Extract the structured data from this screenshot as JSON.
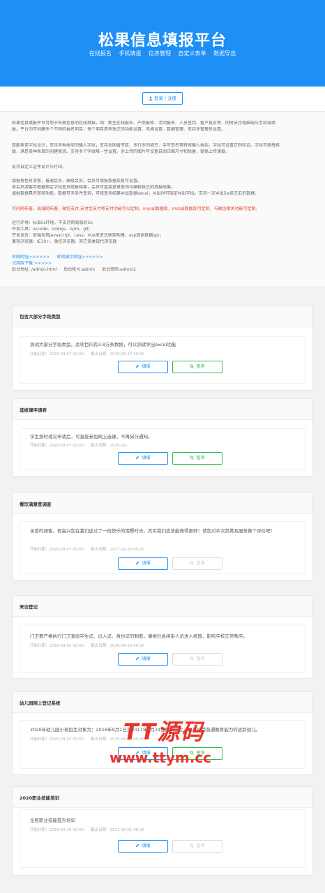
{
  "header": {
    "title": "松果信息填报平台",
    "nav": [
      "在线报名",
      "手机填报",
      "信息管理",
      "自定义表单",
      "数据导出"
    ]
  },
  "topbar": {
    "login_label": "登录 / 注册"
  },
  "intro": {
    "lines": [
      "松果信息填报平台可用于各类信息的在线填报，如：新生在线报名、产品报修、活动报名、人员签到、客户投诉等，同时支持电脑端与手机端填",
      "报。平台内可创建多个不同的报名项目，每个项目具有独立的功能设置、风格设置、数据管理、支持多管理员设置。",
      "智能表单字段设计，支持多种类型的输入字段，支持全国省市区、多行多列填空、手写签名等特殊输入类型。字段可设置正则验证。字段可拖拽排",
      "版，满足各种表单的创建需求。支持多个字段唯一性设置。对上传的图片可设置自动压缩尺寸和质量，提高上传速度。",
      "支持自定义证件设计与打印。",
      "填报角色有游客，普通会员，高级会员。会员可填报数据条数可设置。",
      "非会员游客可根据指定字段查询填报结果，会员可直接登录查询与编辑自己的填报结果。",
      "填报数据具有审核功能，数据可多条件查询，可按查询结果导出数据excel，导出时可指定导出字段。支持一次导出5w条左右的数据。",
      "可内网布署，局域网布署，微信支付,支付宝支付等支付功能可以定制，mysql数据库，mssql数据库可定制，与微信相关功能可定制。",
      "运行环境：标准iis环境，不支持简易版的iis;",
      "开发工具：vscode、nodejs、npm、git;",
      "开发语言：前端采用Javascript、Less、Vue渐进式框架构建，asp提供数据api；",
      "兼容浏览器：IE10+、微信浏览器、其它各类现代浏览器"
    ],
    "links": {
      "official": "官网网址>>>>>>",
      "demo": "官网演示网址>>>>>>",
      "trial": "试用版下载 >>>>>"
    },
    "admin_line": {
      "url": "后台地址: /admin.html",
      "account": "后台帐号:admin",
      "password": "后台密码:admin2"
    }
  },
  "cards": [
    {
      "title": "包含大部分字段类型",
      "desc": "测试大部分字段类型。此项目内有3.8万条数据，可以测试导出excel功能",
      "start": "开始日期：2020-09-07 00:00",
      "end": "截止日期：2025-09-27 00:00",
      "fill_label": "填报",
      "query_label": "查询",
      "query_enabled": true
    },
    {
      "title": "选修课申请表",
      "desc": "学生按时递交申请后，可直接参加网上选课，不再另行通知。",
      "start": "开始日期：2020-09-07 00:00",
      "end": "截止日期：2025-09-",
      "fill_label": "填报",
      "query_label": "查询",
      "query_enabled": true
    },
    {
      "title": "餐饮满意度调查",
      "desc": "亲爱的顾客，很高兴您在我们这过了一段快乐的用餐时光，其实我们应该能做得更好！请您对本次菜肴及服务做个评价吧！",
      "start": "开始日期：2020-09-07 00:00",
      "end": "截止日期：2027-09-30 00:00",
      "fill_label": "填报",
      "query_label": "查询",
      "query_enabled": false
    },
    {
      "title": "来访登记",
      "desc": "门卫要严格执行门卫查验学生证、出入证、身份证的制度。谢绝社会闲杂人员进入校园，影响学校正常秩序。",
      "start": "开始日期：2020-09-02 00:00",
      "end": "截止日期：2026-09-30 00:00",
      "fill_label": "填报",
      "query_label": "查询",
      "query_enabled": false
    },
    {
      "title": "幼儿园网上登记系统",
      "desc": "2020年幼儿园小班招生对象为：2016年9月1日至2017年8月31日期间出生、具有接受普通教育能力的适龄幼儿。",
      "start": "开始日期：2020-09-02 00:00",
      "end": "截止日期：2025-09-30 00:00",
      "fill_label": "填报",
      "query_label": "查询",
      "query_enabled": true
    },
    {
      "title": "2020职业技能培训",
      "desc": "全民职业技能提升培训",
      "start": "开始日期：2020-04-10 00:00",
      "end": "截止日期：2021-10-01 00:00",
      "fill_label": "填报",
      "query_label": "查询",
      "query_enabled": false
    }
  ],
  "watermark": {
    "logo": "TT源码",
    "url": "www.ttym.cc"
  },
  "colors": {
    "primary": "#1e8ff5",
    "success": "#2fb84f",
    "danger": "#e23b2e"
  }
}
